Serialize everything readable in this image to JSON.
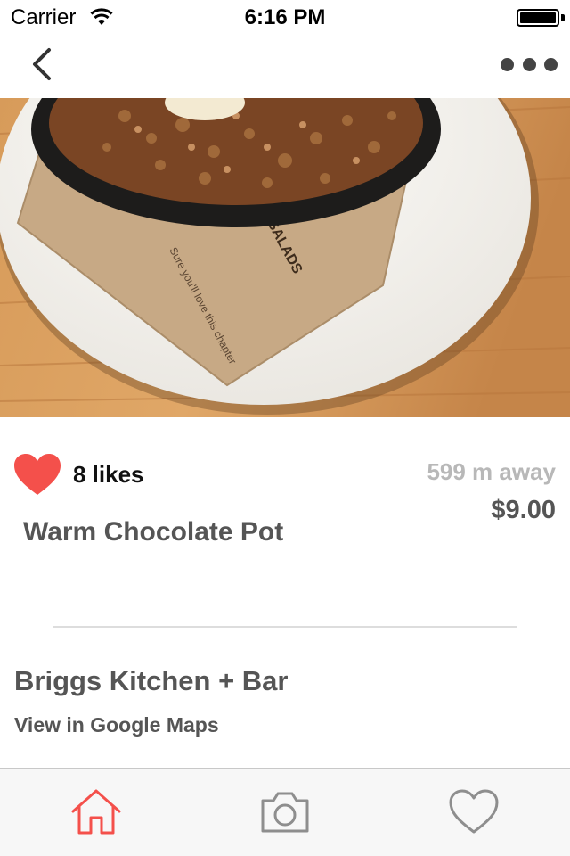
{
  "status_bar": {
    "carrier": "Carrier",
    "time": "6:16 PM"
  },
  "nav": {
    "back_icon": "chevron-left-icon",
    "more_icon": "ellipsis-icon"
  },
  "item": {
    "photo_subject": "Warm Chocolate Pot",
    "likes": "8 likes",
    "distance": "599 m away",
    "price": "$9.00",
    "name": "Warm Chocolate Pot"
  },
  "restaurant": {
    "name": "Briggs Kitchen + Bar",
    "maps_link": "View in Google Maps"
  },
  "tab_bar": {
    "items": [
      {
        "icon": "home-icon",
        "active": true
      },
      {
        "icon": "camera-icon",
        "active": false
      },
      {
        "icon": "heart-icon",
        "active": false
      }
    ]
  },
  "colors": {
    "accent": "#f4504b",
    "muted_text": "#555555",
    "distance_text": "#b8b8b8",
    "tab_inactive": "#8e8e8e"
  }
}
